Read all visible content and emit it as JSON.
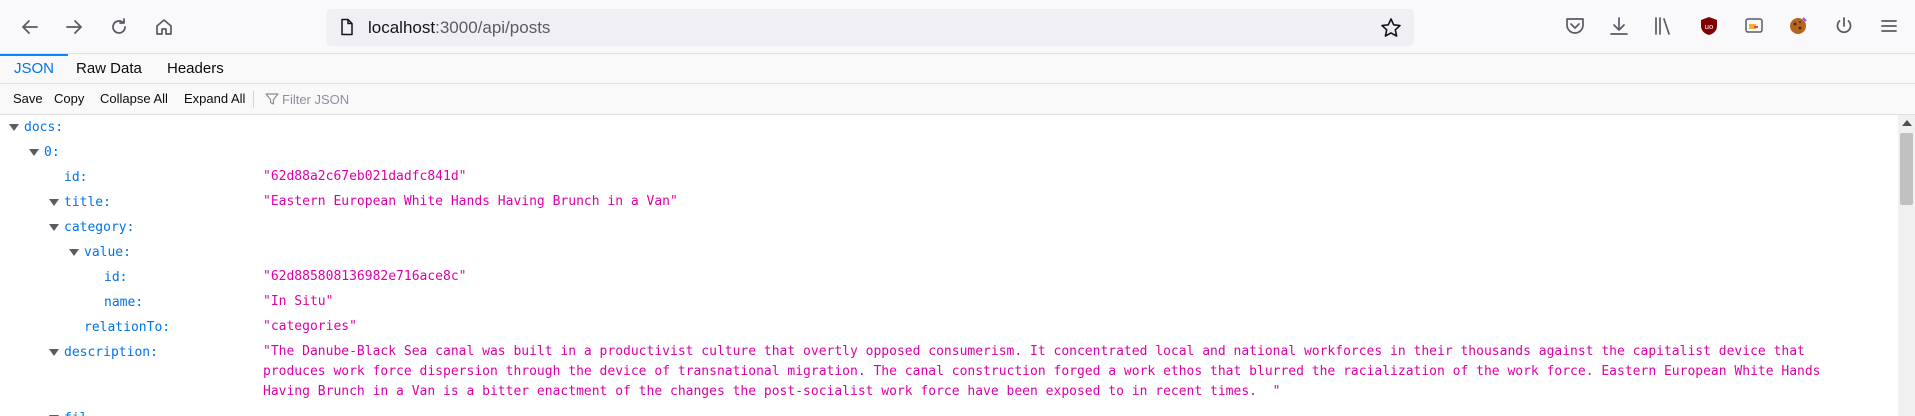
{
  "browser": {
    "url_host": "localhost",
    "url_rest": ":3000/api/posts"
  },
  "viewer": {
    "tabs": [
      {
        "label": "JSON",
        "selected": true
      },
      {
        "label": "Raw Data",
        "selected": false
      },
      {
        "label": "Headers",
        "selected": false
      }
    ],
    "toolbar": {
      "save": "Save",
      "copy": "Copy",
      "collapse_all": "Collapse All",
      "expand_all": "Expand All",
      "filter_placeholder": "Filter JSON"
    }
  },
  "tree": {
    "docs_key": "docs:",
    "item_key": "0:",
    "id_key": "id:",
    "id_val": "\"62d88a2c67eb021dadfc841d\"",
    "title_key": "title:",
    "title_val": "\"Eastern European White Hands Having Brunch in a Van\"",
    "category_key": "category:",
    "value_key": "value:",
    "cat_id_key": "id:",
    "cat_id_val": "\"62d885808136982e716ace8c\"",
    "name_key": "name:",
    "name_val": "\"In Situ\"",
    "relation_key": "relationTo:",
    "relation_val": "\"categories\"",
    "description_key": "description:",
    "description_val": "\"The Danube-Black Sea canal was built in a productivist culture that overtly opposed consumerism. It concentrated local and national workforces in their thousands against the capitalist device that produces work force dispersion through the device of transnational migration. The canal construction forged a work ethos that blurred the racialization of the work force. Eastern European White Hands Having Brunch in a Van is a bitter enactment of the changes the post-socialist work force have been exposed to in recent times.  \"",
    "next_key": "fil"
  }
}
